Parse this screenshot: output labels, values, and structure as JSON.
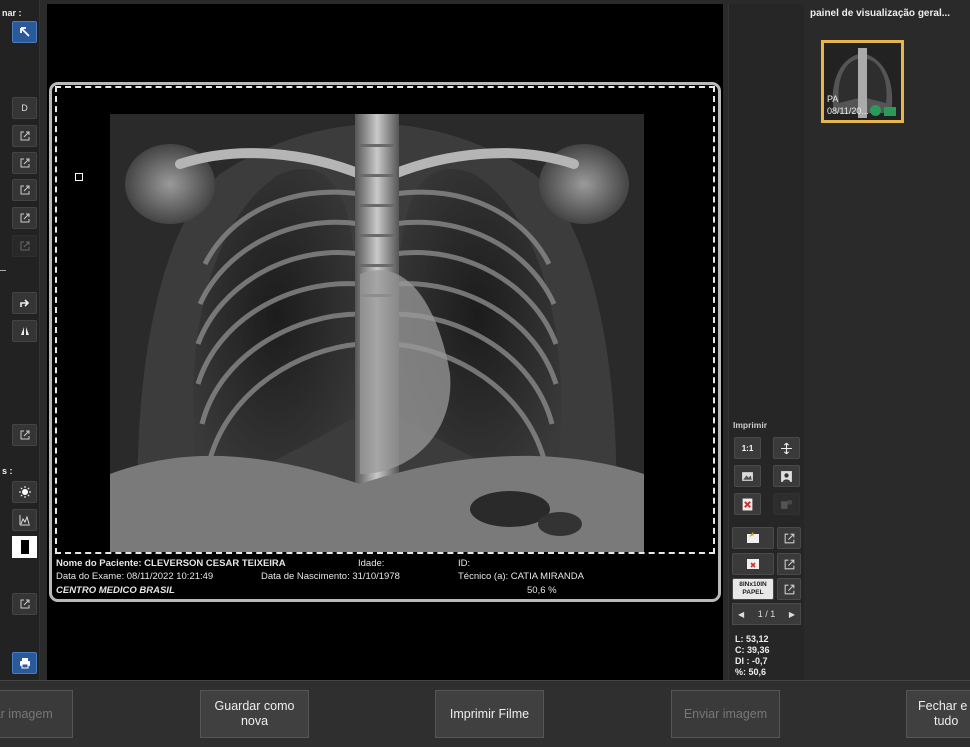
{
  "left_panel": {
    "top_label": "nar :",
    "d_label": "D",
    "section_label": "s :"
  },
  "overview": {
    "title": "painel de visualização geral...",
    "thumb_label": "PA",
    "thumb_date": "08/11/20..."
  },
  "image_info": {
    "patient_label": "Nome do Paciente:",
    "patient_name": "CLEVERSON CESAR TEIXEIRA",
    "age_label": "Idade:",
    "id_label": "ID:",
    "exam_date": "Data do Exame: 08/11/2022 10:21:49",
    "birth_date": "Data de Nascimento: 31/10/1978",
    "technician": "Técnico (a): CATIA MIRANDA",
    "clinic": "CENTRO MEDICO BRASIL",
    "zoom": "50,6 %"
  },
  "print_panel": {
    "title": "Imprimir",
    "btn_1to1": "1:1",
    "film_size_line1": "8INx10IN",
    "film_size_line2": "PAPEL",
    "page_indicator": "1 / 1",
    "stat_L": "L: 53,12",
    "stat_C": "C: 39,36",
    "stat_DI": "DI : -0,7",
    "stat_pct": "%: 50,6"
  },
  "bottom_bar": {
    "btn_edit": "tar imagem",
    "btn_save_line1": "Guardar como",
    "btn_save_line2": "nova",
    "btn_print": "Imprimir Filme",
    "btn_send": "Enviar imagem",
    "btn_close_line1": "Fechar e",
    "btn_close_line2": "tudo"
  },
  "colors": {
    "thumb_border": "#e6b64c",
    "tool_blue": "#2b5a9a",
    "print_red": "#d03030"
  }
}
